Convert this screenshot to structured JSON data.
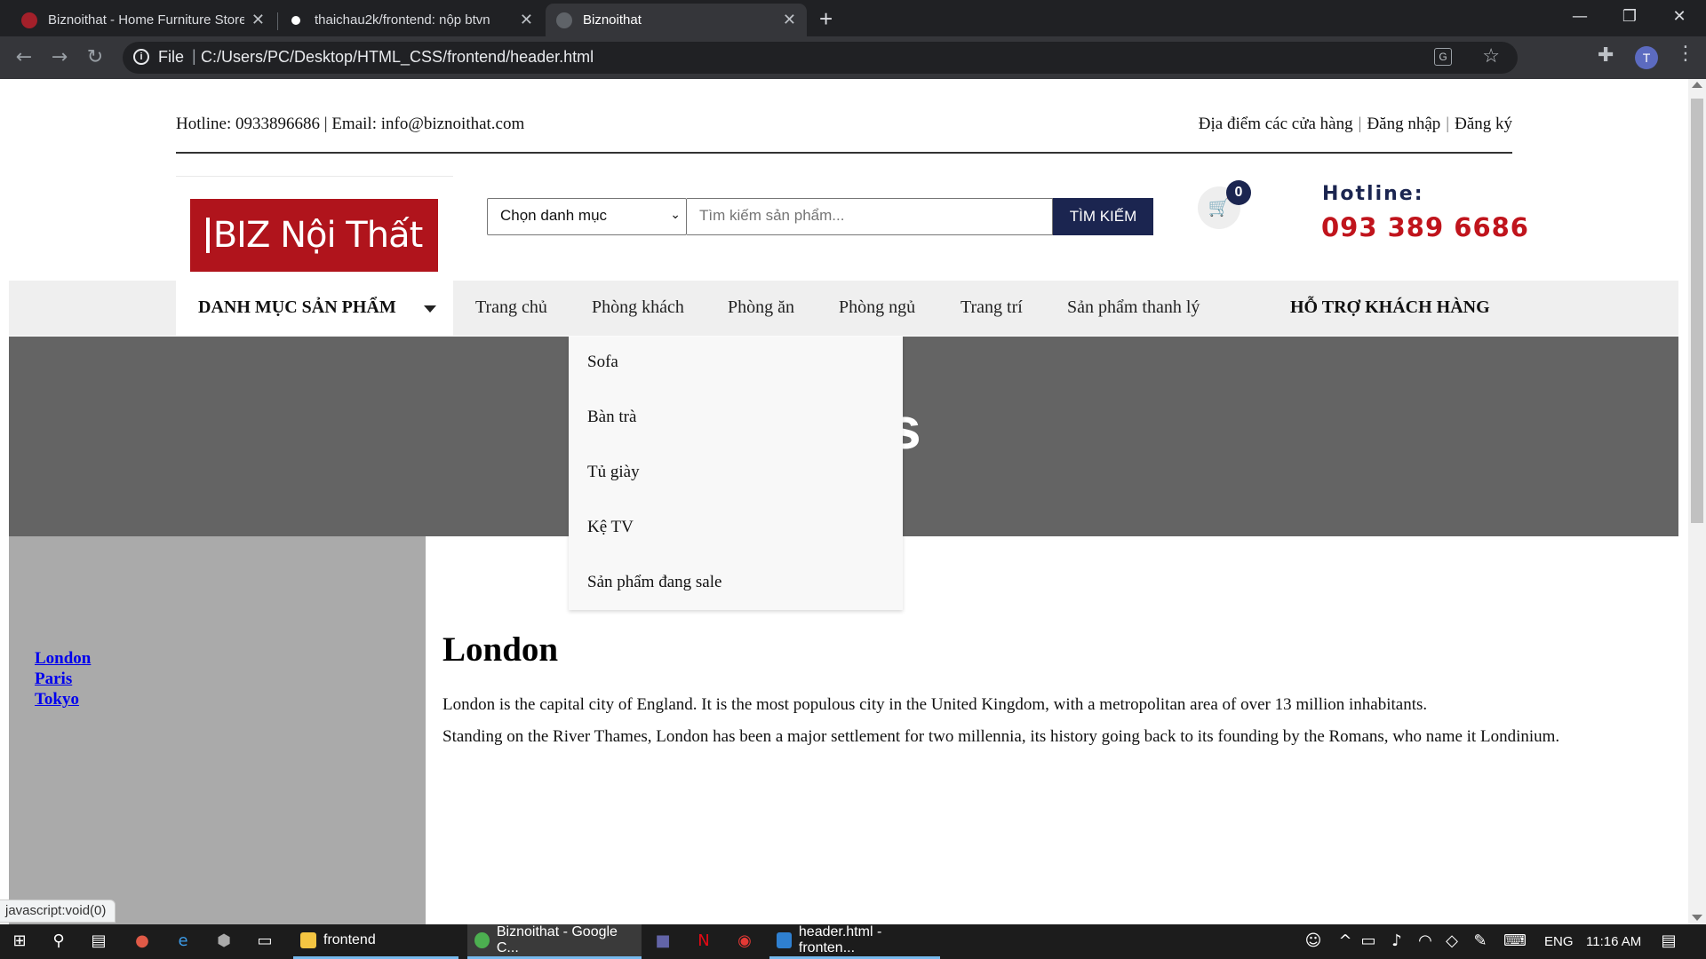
{
  "browser": {
    "tabs": [
      {
        "title": "Biznoithat - Home Furniture Store",
        "favicon": "biz-favicon-icon",
        "active": false
      },
      {
        "title": "thaichau2k/frontend: nộp btvn",
        "favicon": "github-icon",
        "active": false
      },
      {
        "title": "Biznoithat",
        "favicon": "globe-icon",
        "active": true
      }
    ],
    "scheme": "File",
    "url": "C:/Users/PC/Desktop/HTML_CSS/frontend/header.html",
    "profile_initial": "T",
    "status_text": "javascript:void(0)"
  },
  "header": {
    "contact": "Hotline: 0933896686 | Email: info@biznoithat.com",
    "stores": "Địa điểm các cửa hàng",
    "login": "Đăng nhập",
    "register": "Đăng ký",
    "logo_text": "BIZ Nội Thất",
    "category_select": "Chọn danh mục",
    "search_placeholder": "Tìm kiếm sản phẩm...",
    "search_button": "TÌM KIẾM",
    "cart_count": "0",
    "hotline_label": "Hotline:",
    "hotline_number": "093 389 6686"
  },
  "nav": {
    "category_label": "DANH MỤC SẢN PHẨM",
    "items": [
      "Trang chủ",
      "Phòng khách",
      "Phòng ăn",
      "Phòng ngủ",
      "Trang trí",
      "Sản phẩm thanh lý"
    ],
    "support": "HỖ TRỢ KHÁCH HÀNG"
  },
  "dropdown": {
    "items": [
      "Sofa",
      "Bàn trà",
      "Tủ giày",
      "Kệ TV",
      "Sản phẩm đang sale"
    ]
  },
  "banner": {
    "visible_text": "s"
  },
  "sidebar": {
    "links": [
      "London",
      "Paris",
      "Tokyo"
    ]
  },
  "content": {
    "title": "London",
    "p1": "London is the capital city of England. It is the most populous city in the United Kingdom, with a metropolitan area of over 13 million inhabitants.",
    "p2": "Standing on the River Thames, London has been a major settlement for two millennia, its history going back to its founding by the Romans, who name it Londinium."
  },
  "taskbar": {
    "apps": [
      {
        "label": "frontend",
        "icon": "folder-icon"
      },
      {
        "label": "Biznoithat - Google C...",
        "icon": "chrome-icon"
      },
      {
        "label": "header.html - fronten...",
        "icon": "vscode-icon"
      }
    ],
    "language": "ENG",
    "time": "11:16 AM"
  },
  "colors": {
    "brand_red": "#b0141c",
    "brand_navy": "#1b2550",
    "banner_gray": "#646464",
    "sidebar_gray": "#aaaaaa"
  }
}
